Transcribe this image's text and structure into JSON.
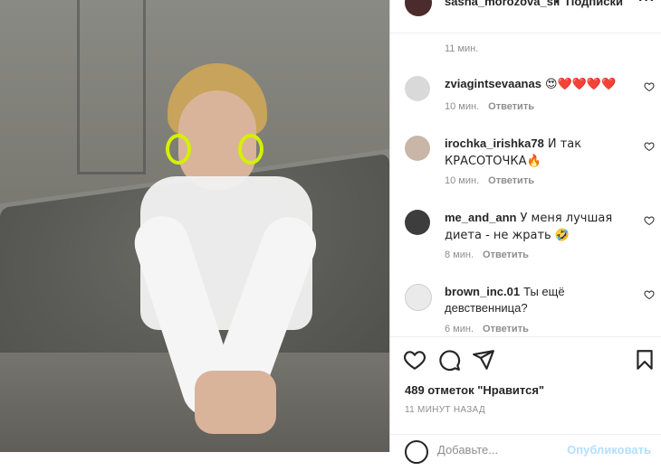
{
  "post": {
    "username": "sasha_morozova_sil",
    "separator": "•",
    "follow_label": "Подписки",
    "more_label": "···",
    "top_time": "11 мин."
  },
  "comments": [
    {
      "user": "zviagintsevaanas",
      "text": "😍❤️❤️❤️❤️",
      "time": "10 мин.",
      "reply": "Ответить"
    },
    {
      "user": "irochka_irishka78",
      "text": "И так КРАСОТОЧКА🔥",
      "time": "10 мин.",
      "reply": "Ответить"
    },
    {
      "user": "me_and_ann",
      "text": "У меня лучшая диета - не жрать 🤣",
      "time": "8 мин.",
      "reply": "Ответить"
    },
    {
      "user": "brown_inc.01",
      "text": "Ты ещё девственница?",
      "time": "6 мин.",
      "reply": "Ответить"
    }
  ],
  "engagement": {
    "likes_text": "489 отметок \"Нравится\"",
    "posted_ago": "11 МИНУТ НАЗАД"
  },
  "add_comment": {
    "placeholder": "Добавьте...",
    "publish_label": "Опубликовать"
  },
  "icons": {
    "like": "heart-icon",
    "comment": "comment-icon",
    "share": "paper-plane-icon",
    "save": "bookmark-icon",
    "emoji": "smile-icon"
  }
}
